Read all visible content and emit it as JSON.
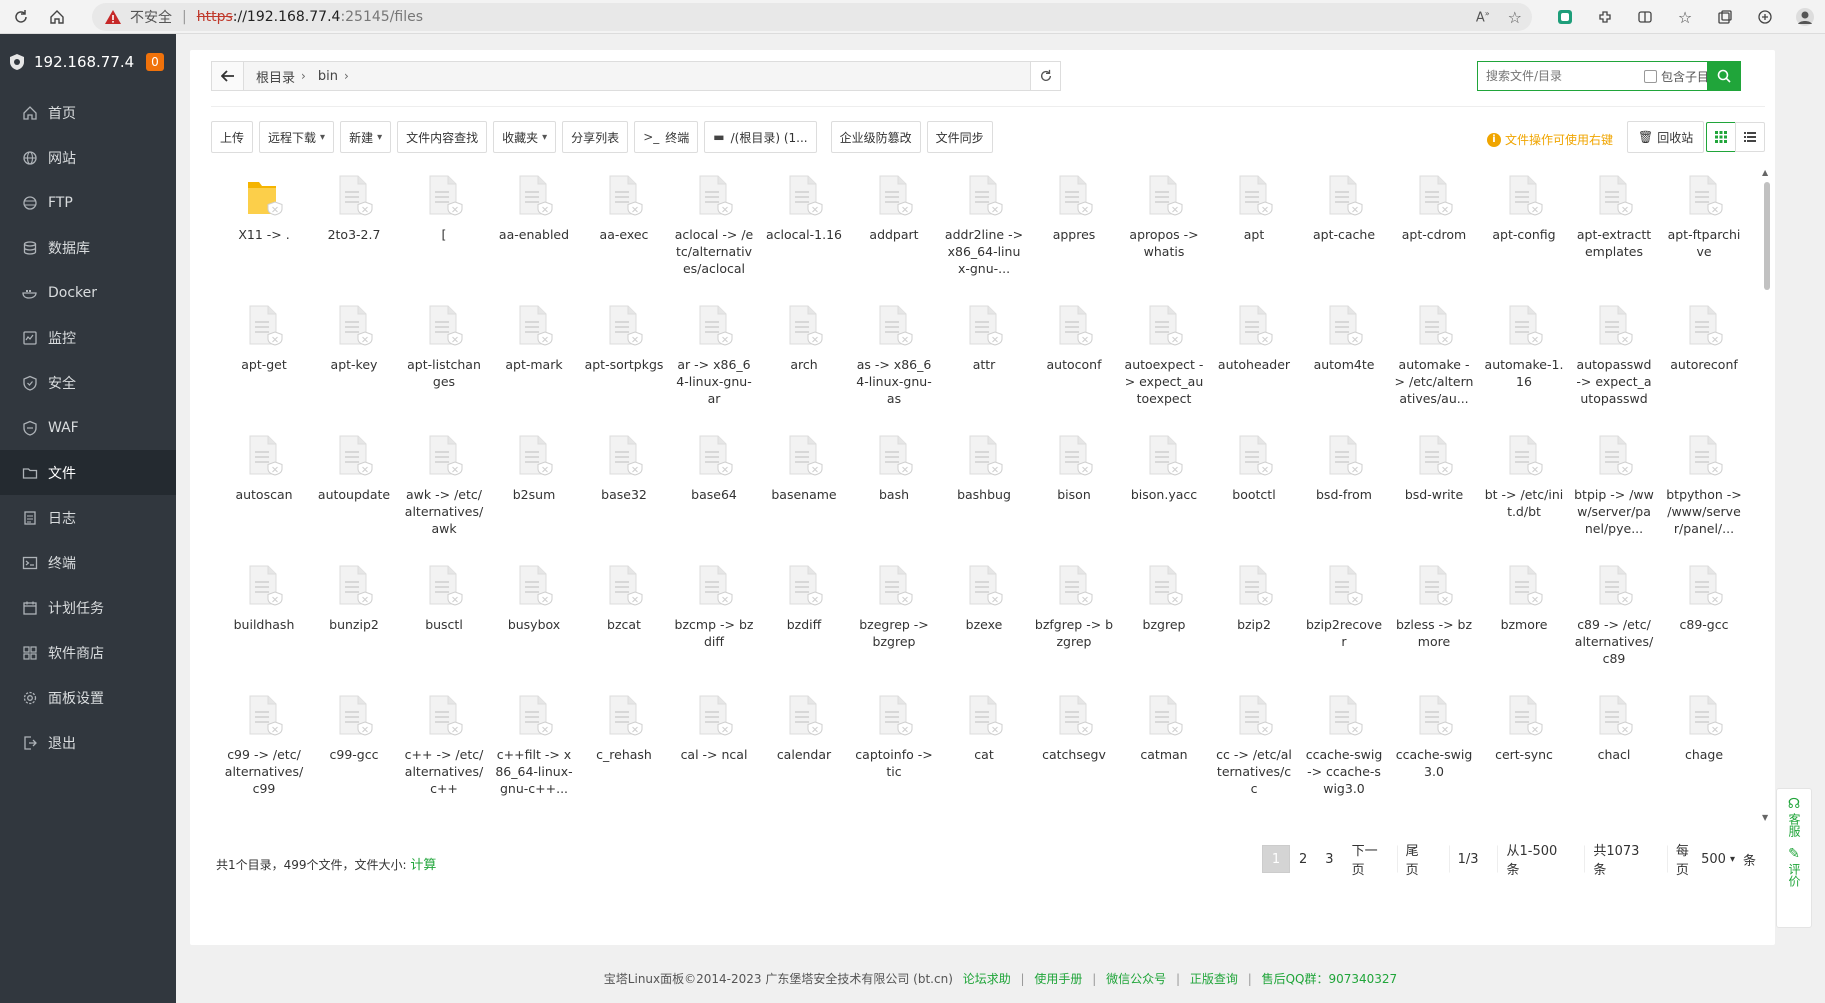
{
  "browser": {
    "not_secure": "不安全",
    "url_scheme": "https",
    "url_host": "://192.168.77.4",
    "url_path": ":25145/files"
  },
  "sidebar": {
    "host": "192.168.77.4",
    "badge": "0",
    "items": [
      {
        "label": "首页",
        "icon": "home-icon"
      },
      {
        "label": "网站",
        "icon": "globe-icon"
      },
      {
        "label": "FTP",
        "icon": "ftp-icon"
      },
      {
        "label": "数据库",
        "icon": "database-icon"
      },
      {
        "label": "Docker",
        "icon": "docker-icon"
      },
      {
        "label": "监控",
        "icon": "monitor-icon"
      },
      {
        "label": "安全",
        "icon": "shield-icon"
      },
      {
        "label": "WAF",
        "icon": "waf-icon"
      },
      {
        "label": "文件",
        "icon": "folder-icon"
      },
      {
        "label": "日志",
        "icon": "log-icon"
      },
      {
        "label": "终端",
        "icon": "terminal-icon"
      },
      {
        "label": "计划任务",
        "icon": "calendar-icon"
      },
      {
        "label": "软件商店",
        "icon": "apps-icon"
      },
      {
        "label": "面板设置",
        "icon": "gear-icon"
      },
      {
        "label": "退出",
        "icon": "logout-icon"
      }
    ],
    "active_index": 8
  },
  "breadcrumb": {
    "root": "根目录",
    "dir": "bin"
  },
  "search": {
    "placeholder": "搜索文件/目录",
    "include_sub": "包含子目录"
  },
  "toolbar": {
    "upload": "上传",
    "remote_download": "远程下载",
    "new": "新建",
    "content_search": "文件内容查找",
    "favorites": "收藏夹",
    "share_list": "分享列表",
    "terminal": "终端",
    "disk": "/(根目录) (1...",
    "anti_tamper": "企业级防篡改",
    "sync": "文件同步",
    "hint": "文件操作可使用右键",
    "recycle": "回收站"
  },
  "files": [
    {
      "name": "X11 -> .",
      "type": "folder"
    },
    {
      "name": "2to3-2.7",
      "type": "file"
    },
    {
      "name": "[",
      "type": "file"
    },
    {
      "name": "aa-enabled",
      "type": "file"
    },
    {
      "name": "aa-exec",
      "type": "file"
    },
    {
      "name": "aclocal -> /etc/alternatives/aclocal",
      "type": "file"
    },
    {
      "name": "aclocal-1.16",
      "type": "file"
    },
    {
      "name": "addpart",
      "type": "file"
    },
    {
      "name": "addr2line -> x86_64-linux-gnu-...",
      "type": "file"
    },
    {
      "name": "appres",
      "type": "file"
    },
    {
      "name": "apropos -> whatis",
      "type": "file"
    },
    {
      "name": "apt",
      "type": "file"
    },
    {
      "name": "apt-cache",
      "type": "file"
    },
    {
      "name": "apt-cdrom",
      "type": "file"
    },
    {
      "name": "apt-config",
      "type": "file"
    },
    {
      "name": "apt-extracttemplates",
      "type": "file"
    },
    {
      "name": "apt-ftparchive",
      "type": "file"
    },
    {
      "name": "apt-get",
      "type": "file"
    },
    {
      "name": "apt-key",
      "type": "file"
    },
    {
      "name": "apt-listchanges",
      "type": "file"
    },
    {
      "name": "apt-mark",
      "type": "file"
    },
    {
      "name": "apt-sortpkgs",
      "type": "file"
    },
    {
      "name": "ar -> x86_64-linux-gnu-ar",
      "type": "file"
    },
    {
      "name": "arch",
      "type": "file"
    },
    {
      "name": "as -> x86_64-linux-gnu-as",
      "type": "file"
    },
    {
      "name": "attr",
      "type": "file"
    },
    {
      "name": "autoconf",
      "type": "file"
    },
    {
      "name": "autoexpect -> expect_autoexpect",
      "type": "file"
    },
    {
      "name": "autoheader",
      "type": "file"
    },
    {
      "name": "autom4te",
      "type": "file"
    },
    {
      "name": "automake -> /etc/alternatives/au...",
      "type": "file"
    },
    {
      "name": "automake-1.16",
      "type": "file"
    },
    {
      "name": "autopasswd -> expect_autopasswd",
      "type": "file"
    },
    {
      "name": "autoreconf",
      "type": "file"
    },
    {
      "name": "autoscan",
      "type": "file"
    },
    {
      "name": "autoupdate",
      "type": "file"
    },
    {
      "name": "awk -> /etc/alternatives/awk",
      "type": "file"
    },
    {
      "name": "b2sum",
      "type": "file"
    },
    {
      "name": "base32",
      "type": "file"
    },
    {
      "name": "base64",
      "type": "file"
    },
    {
      "name": "basename",
      "type": "file"
    },
    {
      "name": "bash",
      "type": "file"
    },
    {
      "name": "bashbug",
      "type": "file"
    },
    {
      "name": "bison",
      "type": "file"
    },
    {
      "name": "bison.yacc",
      "type": "file"
    },
    {
      "name": "bootctl",
      "type": "file"
    },
    {
      "name": "bsd-from",
      "type": "file"
    },
    {
      "name": "bsd-write",
      "type": "file"
    },
    {
      "name": "bt -> /etc/init.d/bt",
      "type": "file"
    },
    {
      "name": "btpip -> /www/server/panel/pye...",
      "type": "file"
    },
    {
      "name": "btpython -> /www/server/panel/...",
      "type": "file"
    },
    {
      "name": "buildhash",
      "type": "file"
    },
    {
      "name": "bunzip2",
      "type": "file"
    },
    {
      "name": "busctl",
      "type": "file"
    },
    {
      "name": "busybox",
      "type": "file"
    },
    {
      "name": "bzcat",
      "type": "file"
    },
    {
      "name": "bzcmp -> bzdiff",
      "type": "file"
    },
    {
      "name": "bzdiff",
      "type": "file"
    },
    {
      "name": "bzegrep -> bzgrep",
      "type": "file"
    },
    {
      "name": "bzexe",
      "type": "file"
    },
    {
      "name": "bzfgrep -> bzgrep",
      "type": "file"
    },
    {
      "name": "bzgrep",
      "type": "file"
    },
    {
      "name": "bzip2",
      "type": "file"
    },
    {
      "name": "bzip2recover",
      "type": "file"
    },
    {
      "name": "bzless -> bzmore",
      "type": "file"
    },
    {
      "name": "bzmore",
      "type": "file"
    },
    {
      "name": "c89 -> /etc/alternatives/c89",
      "type": "file"
    },
    {
      "name": "c89-gcc",
      "type": "file"
    },
    {
      "name": "c99 -> /etc/alternatives/c99",
      "type": "file"
    },
    {
      "name": "c99-gcc",
      "type": "file"
    },
    {
      "name": "c++ -> /etc/alternatives/c++",
      "type": "file"
    },
    {
      "name": "c++filt -> x86_64-linux-gnu-c++...",
      "type": "file"
    },
    {
      "name": "c_rehash",
      "type": "file"
    },
    {
      "name": "cal -> ncal",
      "type": "file"
    },
    {
      "name": "calendar",
      "type": "file"
    },
    {
      "name": "captoinfo -> tic",
      "type": "file"
    },
    {
      "name": "cat",
      "type": "file"
    },
    {
      "name": "catchsegv",
      "type": "file"
    },
    {
      "name": "catman",
      "type": "file"
    },
    {
      "name": "cc -> /etc/alternatives/cc",
      "type": "file"
    },
    {
      "name": "ccache-swig -> ccache-swig3.0",
      "type": "file"
    },
    {
      "name": "ccache-swig3.0",
      "type": "file"
    },
    {
      "name": "cert-sync",
      "type": "file"
    },
    {
      "name": "chacl",
      "type": "file"
    },
    {
      "name": "chage",
      "type": "file"
    }
  ],
  "summary": {
    "text": "共1个目录，499个文件，文件大小:",
    "calc": "计算"
  },
  "pager": {
    "pages": [
      "1",
      "2",
      "3"
    ],
    "next": "下一页",
    "last": "尾页",
    "page_info": "1/3",
    "range": "从1-500条",
    "total": "共1073条",
    "per_page_label": "每页",
    "per_page": "500",
    "unit": "条"
  },
  "float": {
    "service": "客服",
    "rate": "评价"
  },
  "footer": {
    "copy": "宝塔Linux面板©2014-2023 广东堡塔安全技术有限公司 (bt.cn)",
    "links": [
      "论坛求助",
      "使用手册",
      "微信公众号",
      "正版查询",
      "售后QQ群：907340327"
    ]
  },
  "colors": {
    "accent": "#20a53a",
    "sidebar": "#31373e",
    "warning": "#f0a500"
  }
}
